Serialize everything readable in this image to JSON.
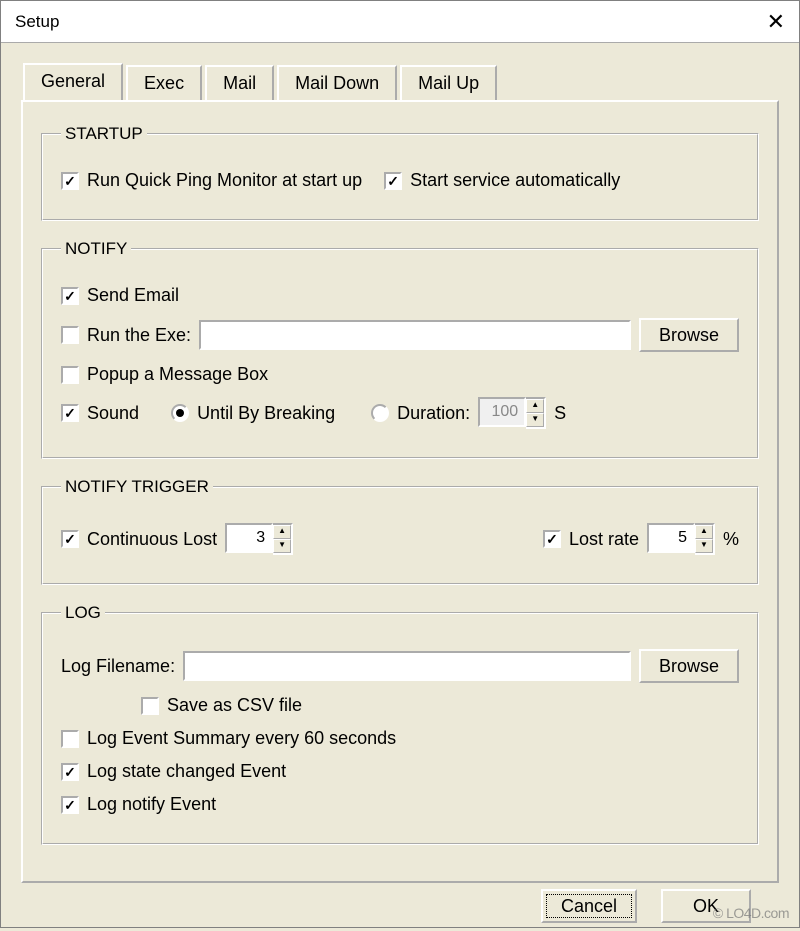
{
  "window": {
    "title": "Setup"
  },
  "tabs": {
    "items": [
      {
        "label": "General",
        "active": true
      },
      {
        "label": "Exec",
        "active": false
      },
      {
        "label": "Mail",
        "active": false
      },
      {
        "label": "Mail Down",
        "active": false
      },
      {
        "label": "Mail Up",
        "active": false
      }
    ]
  },
  "startup": {
    "title": "STARTUP",
    "run_at_startup": {
      "label": "Run Quick Ping Monitor at start up",
      "checked": true
    },
    "start_service": {
      "label": "Start service automatically",
      "checked": true
    }
  },
  "notify": {
    "title": "NOTIFY",
    "send_email": {
      "label": "Send Email",
      "checked": true
    },
    "run_exe": {
      "label": "Run the Exe:",
      "checked": false,
      "value": "",
      "browse": "Browse"
    },
    "popup": {
      "label": "Popup a Message Box",
      "checked": false
    },
    "sound": {
      "label": "Sound",
      "checked": true,
      "mode": "breaking",
      "until_breaking_label": "Until By Breaking",
      "duration_label": "Duration:",
      "duration_value": "100",
      "duration_unit": "S"
    }
  },
  "notify_trigger": {
    "title": "NOTIFY TRIGGER",
    "continuous_lost": {
      "label": "Continuous Lost",
      "checked": true,
      "value": "3"
    },
    "lost_rate": {
      "label": "Lost rate",
      "checked": true,
      "value": "5",
      "unit": "%"
    }
  },
  "log": {
    "title": "LOG",
    "filename_label": "Log Filename:",
    "filename_value": "",
    "browse": "Browse",
    "save_csv": {
      "label": "Save as CSV file",
      "checked": false
    },
    "event_summary": {
      "label": "Log Event Summary every 60 seconds",
      "checked": false
    },
    "state_changed": {
      "label": "Log state changed Event",
      "checked": true
    },
    "notify_event": {
      "label": "Log notify Event",
      "checked": true
    }
  },
  "buttons": {
    "cancel": "Cancel",
    "ok": "OK"
  },
  "watermark": "© LO4D.com"
}
